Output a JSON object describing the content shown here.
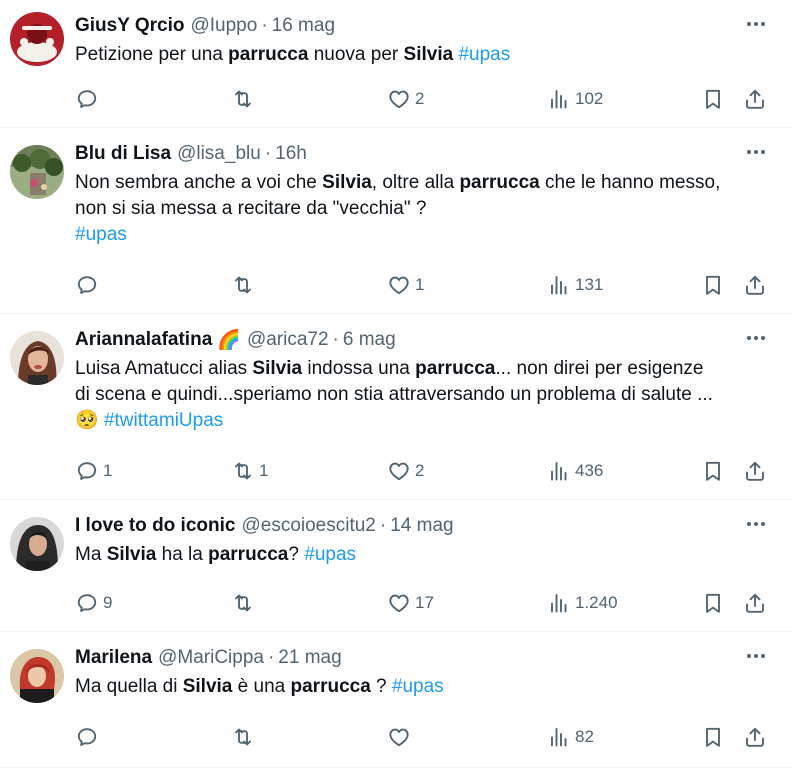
{
  "tweets": [
    {
      "name": "GiusY Qrcio",
      "handle": "@Iuppo",
      "time": "16 mag",
      "emoji": "",
      "lines": [
        [
          {
            "t": "Petizione per una ",
            "s": "n"
          },
          {
            "t": "parrucca",
            "s": "b"
          },
          {
            "t": " nuova per ",
            "s": "n"
          },
          {
            "t": "Silvia",
            "s": "b"
          },
          {
            "t": " ",
            "s": "n"
          },
          {
            "t": "#upas",
            "s": "h"
          }
        ]
      ],
      "replies": "",
      "retweets": "",
      "likes": "2",
      "views": "102",
      "avatar_icon": "christmas-hat-avatar",
      "avatar_color": "#b3202a"
    },
    {
      "name": "Blu di Lisa",
      "handle": "@lisa_blu",
      "time": "16h",
      "emoji": "",
      "lines": [
        [
          {
            "t": "Non sembra anche a voi che ",
            "s": "n"
          },
          {
            "t": "Silvia",
            "s": "b"
          },
          {
            "t": ", oltre alla ",
            "s": "n"
          },
          {
            "t": "parrucca",
            "s": "b"
          },
          {
            "t": " che le hanno messo,",
            "s": "n"
          }
        ],
        [
          {
            "t": "non si sia messa a recitare da \"vecchia\" ?",
            "s": "n"
          }
        ],
        [
          {
            "t": "#upas",
            "s": "h"
          }
        ]
      ],
      "replies": "",
      "retweets": "",
      "likes": "1",
      "views": "131",
      "avatar_icon": "garden-avatar",
      "avatar_color": "#4f6b3a"
    },
    {
      "name": "Ariannalafatina",
      "handle": "@arica72",
      "time": "6 mag",
      "emoji": "🌈",
      "lines": [
        [
          {
            "t": "Luisa Amatucci alias ",
            "s": "n"
          },
          {
            "t": "Silvia",
            "s": "b"
          },
          {
            "t": " indossa una ",
            "s": "n"
          },
          {
            "t": "parrucca",
            "s": "b"
          },
          {
            "t": "... non direi per esigenze",
            "s": "n"
          }
        ],
        [
          {
            "t": "di scena e quindi...speriamo non stia attraversando un problema di salute ...",
            "s": "n"
          }
        ],
        [
          {
            "t": "🥺",
            "s": "e"
          },
          {
            "t": " ",
            "s": "n"
          },
          {
            "t": "#twittamiUpas",
            "s": "h"
          }
        ]
      ],
      "replies": "1",
      "retweets": "1",
      "likes": "2",
      "views": "436",
      "avatar_icon": "woman-portrait-avatar",
      "avatar_color": "#6b3b2a"
    },
    {
      "name": "I love to do iconic",
      "handle": "@escoioescitu2",
      "time": "14 mag",
      "emoji": "",
      "lines": [
        [
          {
            "t": "Ma ",
            "s": "n"
          },
          {
            "t": "Silvia",
            "s": "b"
          },
          {
            "t": " ha la ",
            "s": "n"
          },
          {
            "t": "parrucca",
            "s": "b"
          },
          {
            "t": "? ",
            "s": "n"
          },
          {
            "t": "#upas",
            "s": "h"
          }
        ]
      ],
      "replies": "9",
      "retweets": "",
      "likes": "17",
      "views": "1.240",
      "avatar_icon": "dark-hair-avatar",
      "avatar_color": "#2b2b2b"
    },
    {
      "name": "Marilena",
      "handle": "@MariCippa",
      "time": "21 mag",
      "emoji": "",
      "lines": [
        [
          {
            "t": "Ma quella di ",
            "s": "n"
          },
          {
            "t": "Silvia",
            "s": "b"
          },
          {
            "t": " è una ",
            "s": "n"
          },
          {
            "t": "parrucca",
            "s": "b"
          },
          {
            "t": " ? ",
            "s": "n"
          },
          {
            "t": "#upas",
            "s": "h"
          }
        ]
      ],
      "replies": "",
      "retweets": "",
      "likes": "",
      "views": "82",
      "avatar_icon": "red-hair-avatar",
      "avatar_color": "#c0392b"
    }
  ],
  "colors": {
    "text": "#0f1419",
    "secondary": "#536471",
    "hashtag": "#1d9bf0",
    "divider": "#eff3f4"
  }
}
